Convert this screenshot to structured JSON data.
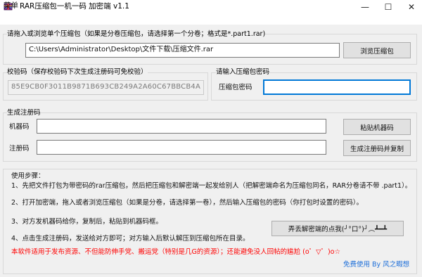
{
  "window": {
    "title": "RAR压缩包一机一码   加密端 v1.1",
    "icons": {
      "app": "archive-icon",
      "minimize": "minimize-icon",
      "maximize": "maximize-icon",
      "close": "close-icon"
    },
    "min_glyph": "—",
    "max_glyph": "☐",
    "close_glyph": "✕"
  },
  "menu": {
    "items": [
      {
        "label": "菜单"
      }
    ]
  },
  "archive_section": {
    "title": "请拖入或浏览单个压缩包（如果是分卷压缩包，请选择第一个分卷；格式是*.part1.rar)",
    "path_value": "C:\\Users\\Administrator\\Desktop\\文件下载\\压缩文件.rar",
    "browse_button": "浏览压缩包"
  },
  "checksum_section": {
    "title": "校验码（保存校验码下次生成注册码可免校验）",
    "value": "85E9CB0F3011B9871B693CB249A2A60C67BBCB4A"
  },
  "password_section": {
    "title": "请输入压缩包密码",
    "label": "压缩包密码",
    "value": ""
  },
  "register_section": {
    "title": "生成注册码",
    "machine_label": "机器码",
    "machine_value": "",
    "paste_button": "粘贴机器码",
    "regcode_label": "注册码",
    "regcode_value": "",
    "generate_button": "生成注册码并复制"
  },
  "steps_section": {
    "title": "使用步骤：",
    "steps": [
      "1、先把文件打包为带密码的rar压缩包，然后把压缩包和解密端一起发给别人（把解密端命名为压缩包同名，RAR分卷请不带 .part1）。",
      "2、打开加密端，拖入或者浏览压缩包（如果是分卷，请选择第一卷），然后输入压缩包的密码（你打包时设置的密码）。",
      "3、对方发机器码给你，复制后，粘贴到机器码框。",
      "4、点击生成注册码，发送给对方即可；对方输入后默认解压到压缩包所在目录。"
    ],
    "discard_button": "弄丢解密端的点我(╯°口°)╯︵┻━┻",
    "notice": "本软件适用于发布资源、不但能防伸手党、搬运党（特别是几G的资源）；还能避免没人回帖的尴尬 (o゜▽゜)o☆",
    "footer_link": "免费使用 By 风之暇想"
  },
  "colors": {
    "notice": "#ff0000",
    "link": "#1e6fd9",
    "focus": "#0078d7",
    "checksum_text": "#7a7a7a"
  }
}
